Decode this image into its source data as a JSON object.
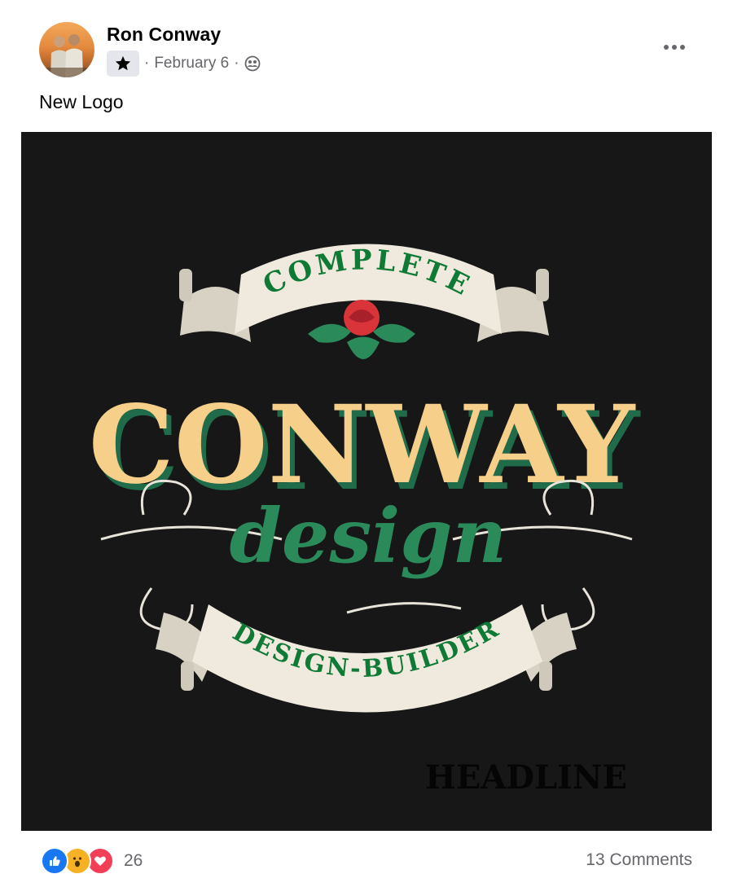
{
  "post": {
    "author": "Ron Conway",
    "date": "February 6",
    "separator": "·",
    "text": "New Logo",
    "badge_icon": "star-icon",
    "audience_icon": "friends-icon",
    "more_icon": "more-dots-icon"
  },
  "logo": {
    "banner_top": "COMPLETE",
    "title": "CONWAY",
    "subtitle": "design",
    "banner_bottom": "DESIGN-BUILDER",
    "watermark": "HEADLINE",
    "colors": {
      "background": "#171717",
      "title": "#f6cf8a",
      "green": "#2b8a5a",
      "banner": "#efeadd",
      "banner_text": "#0f7a35",
      "rose": "#d9343a"
    }
  },
  "footer": {
    "reaction_icons": [
      "like-icon",
      "wow-icon",
      "love-icon"
    ],
    "reaction_count": "26",
    "comments": "13 Comments"
  }
}
